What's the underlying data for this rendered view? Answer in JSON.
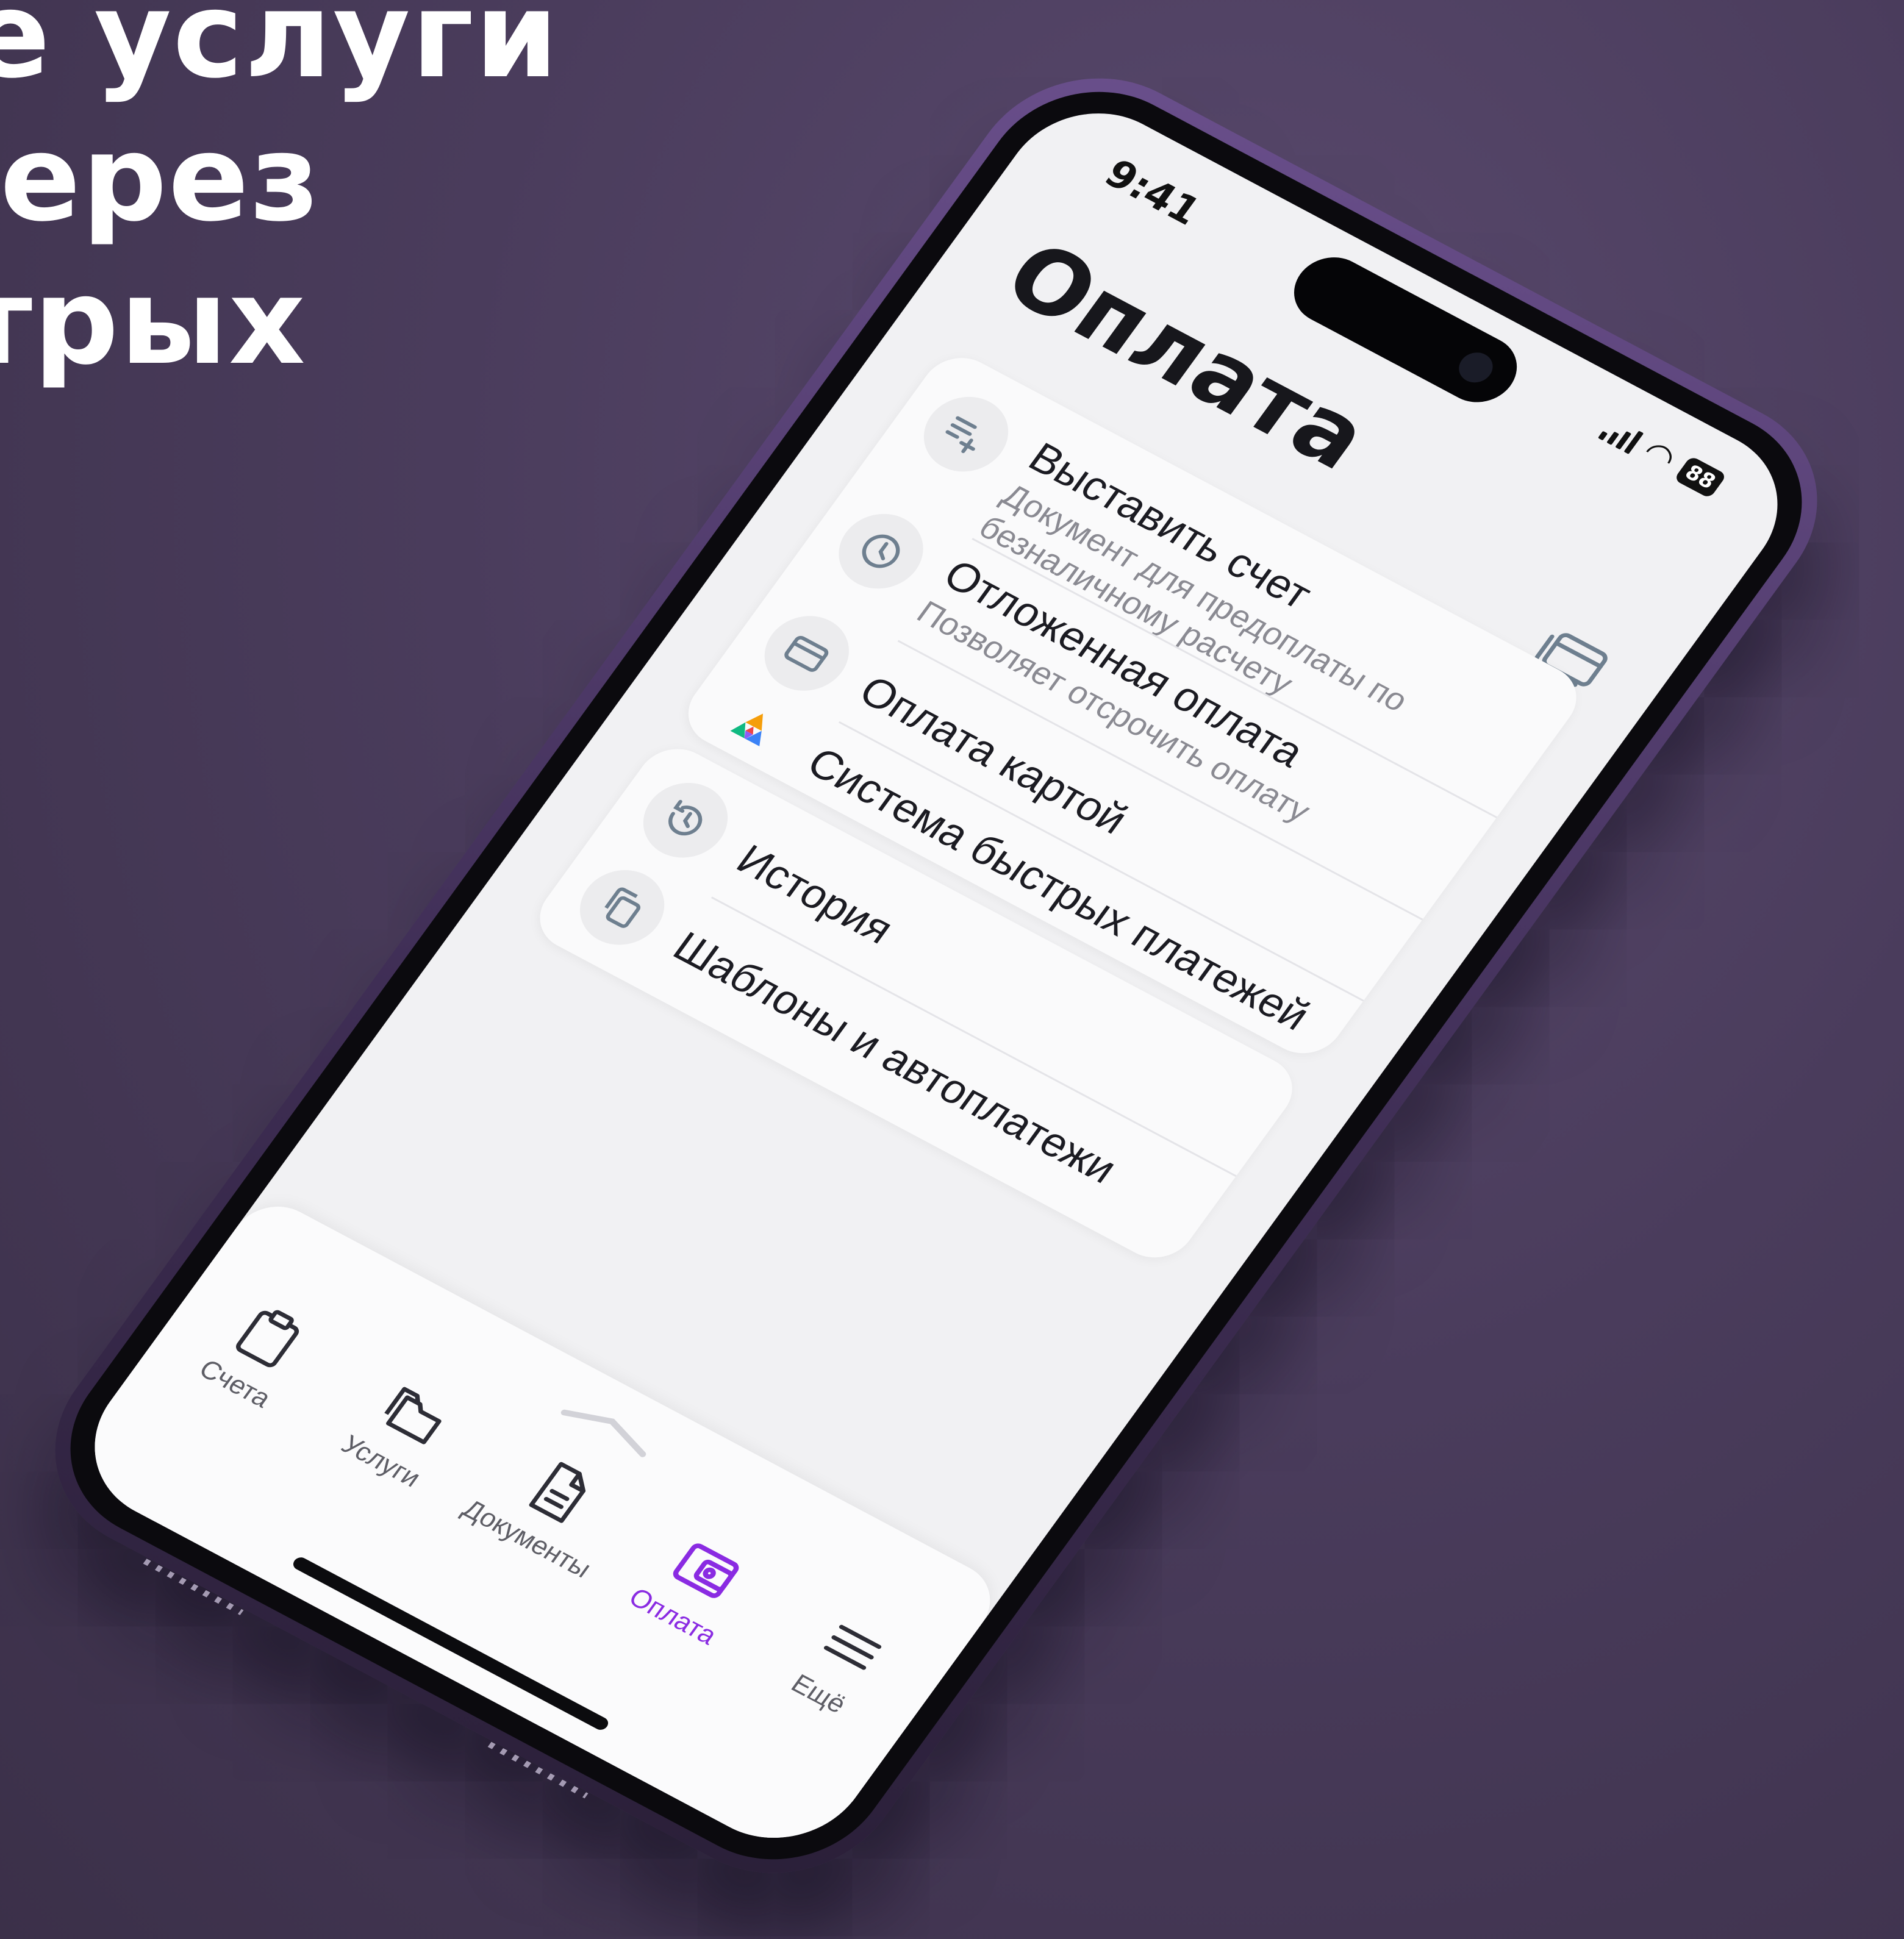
{
  "headline": {
    "line1": "е услуги",
    "line2": "ерез",
    "line3": "трых"
  },
  "status_bar": {
    "time": "9:41",
    "battery": "88"
  },
  "page_title": "Оплата",
  "menu_group_1": [
    {
      "title": "Выставить счет",
      "subtitle": "Документ для предоплаты по безналичному расчету",
      "icon": "add-list-icon"
    },
    {
      "title": "Отложенная оплата",
      "subtitle": "Позволяет отсрочить оплату",
      "icon": "clock-icon"
    },
    {
      "title": "Оплата картой",
      "subtitle": "",
      "icon": "card-icon"
    },
    {
      "title": "Система быстрых платежей",
      "subtitle": "",
      "icon": "sbp-logo-icon"
    }
  ],
  "menu_group_2": [
    {
      "title": "История",
      "icon": "history-icon"
    },
    {
      "title": "Шаблоны и автоплатежи",
      "icon": "copy-icon"
    }
  ],
  "tabbar": {
    "tabs": [
      {
        "label": "Счета",
        "icon": "clipboard-icon",
        "active": false
      },
      {
        "label": "Услуги",
        "icon": "folder-icon",
        "active": false
      },
      {
        "label": "Документы",
        "icon": "document-icon",
        "active": false
      },
      {
        "label": "Оплата",
        "icon": "wallet-icon",
        "active": true
      },
      {
        "label": "Ещё",
        "icon": "menu-icon",
        "active": false
      }
    ]
  },
  "colors": {
    "accent": "#8a2be2",
    "background": "#4a3c5c",
    "screen": "#f1f1f3"
  }
}
